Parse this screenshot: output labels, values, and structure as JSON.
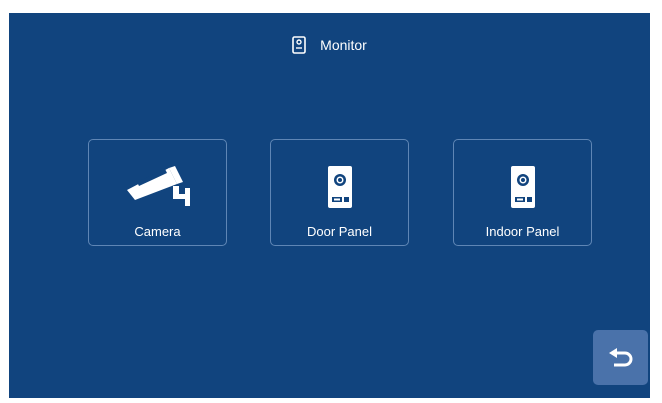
{
  "header": {
    "icon": "door-panel-icon",
    "title": "Monitor"
  },
  "tiles": [
    {
      "label": "Camera",
      "icon": "cctv-camera-icon"
    },
    {
      "label": "Door Panel",
      "icon": "door-panel-icon"
    },
    {
      "label": "Indoor Panel",
      "icon": "indoor-panel-icon"
    }
  ],
  "back_button": {
    "icon": "return-arrow-icon"
  },
  "colors": {
    "background": "#11447e",
    "tile_border": "#a0bee1",
    "back_button": "#4a72aa",
    "text": "#ffffff"
  }
}
